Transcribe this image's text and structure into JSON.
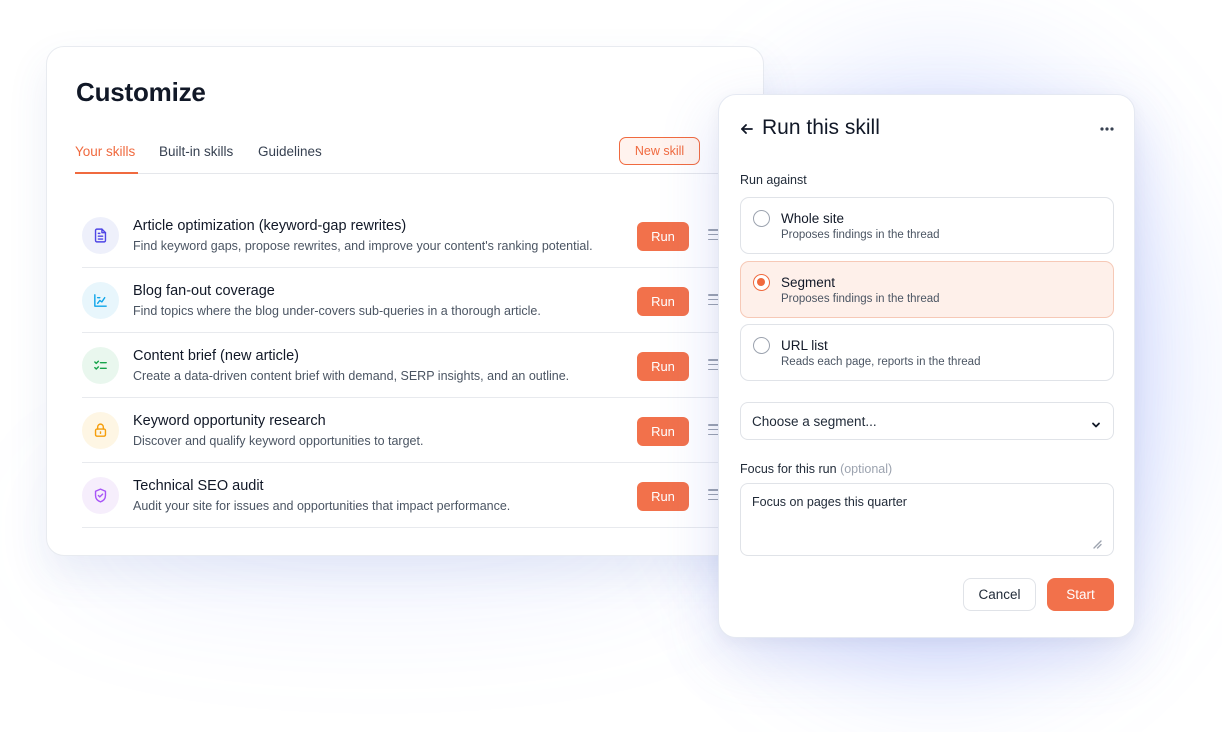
{
  "customize": {
    "title": "Customize",
    "tabs": [
      {
        "label": "Your skills",
        "active": true
      },
      {
        "label": "Built-in skills",
        "active": false
      },
      {
        "label": "Guidelines",
        "active": false
      }
    ],
    "new_skill_label": "New skill",
    "run_label": "Run",
    "skills": [
      {
        "name": "Article optimization (keyword-gap rewrites)",
        "description": "Find keyword gaps, propose rewrites, and improve your content's ranking potential.",
        "icon": "document-icon",
        "icon_color": "#4f46e5",
        "icon_bg": "#eef0fb"
      },
      {
        "name": "Blog fan-out coverage",
        "description": "Find topics where the blog under-covers sub-queries in a thorough article.",
        "icon": "chart-icon",
        "icon_color": "#0ea5e9",
        "icon_bg": "#e8f6fc"
      },
      {
        "name": "Content brief (new article)",
        "description": "Create a data-driven content brief with demand, SERP insights, and an outline.",
        "icon": "checklist-icon",
        "icon_color": "#16a34a",
        "icon_bg": "#e9f7ee"
      },
      {
        "name": "Keyword opportunity research",
        "description": "Discover and qualify keyword opportunities to target.",
        "icon": "lock-icon",
        "icon_color": "#f59e0b",
        "icon_bg": "#fef6e4"
      },
      {
        "name": "Technical SEO audit",
        "description": "Audit your site for issues and opportunities that impact performance.",
        "icon": "shield-icon",
        "icon_color": "#a855f7",
        "icon_bg": "#f6eefc"
      }
    ]
  },
  "run_panel": {
    "title": "Run this skill",
    "run_against_label": "Run against",
    "options": [
      {
        "title": "Whole site",
        "description": "Proposes findings in the thread",
        "selected": false
      },
      {
        "title": "Segment",
        "description": "Proposes findings in the thread",
        "selected": true
      },
      {
        "title": "URL list",
        "description": "Reads each page, reports in the thread",
        "selected": false
      }
    ],
    "segment_select": "Choose a segment...",
    "focus_label": "Focus for this run",
    "focus_optional": "(optional)",
    "focus_value": "Focus on pages this quarter",
    "cancel_label": "Cancel",
    "start_label": "Start"
  },
  "colors": {
    "accent": "#f2714b",
    "accent_soft": "#fef0ea"
  }
}
